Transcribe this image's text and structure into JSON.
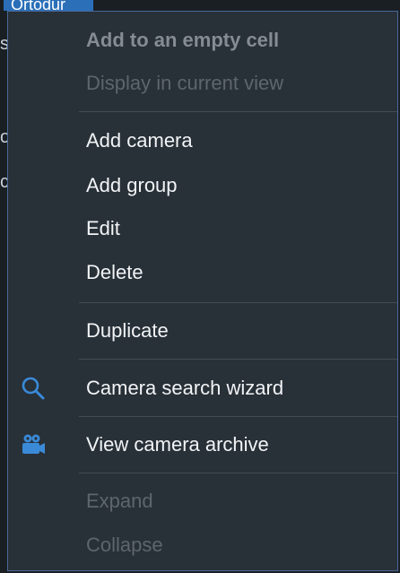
{
  "background": {
    "tag_text": "Ortodur",
    "fragments": [
      "s",
      "o",
      "c"
    ]
  },
  "menu": {
    "header_add_empty": "Add to an empty cell",
    "display_current_view": "Display in current view",
    "add_camera": "Add camera",
    "add_group": "Add group",
    "edit": "Edit",
    "delete": "Delete",
    "duplicate": "Duplicate",
    "camera_search_wizard": "Camera search wizard",
    "view_camera_archive": "View camera archive",
    "expand": "Expand",
    "collapse": "Collapse"
  },
  "icons": {
    "search": "magnifier-icon",
    "archive": "video-camera-icon"
  },
  "colors": {
    "menu_bg": "#283038",
    "border": "#4a6a9a",
    "icon_accent": "#3a8ad8",
    "text": "#f2f4f6",
    "disabled_text": "#707880"
  }
}
